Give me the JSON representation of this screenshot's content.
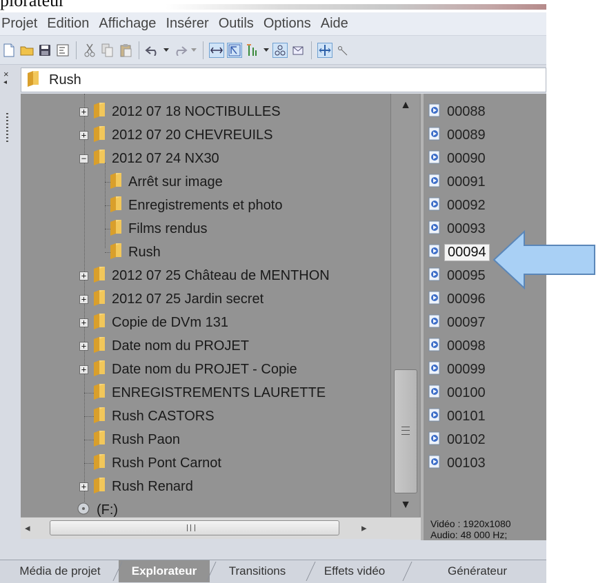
{
  "window": {
    "title_fragment": "plorateur"
  },
  "menubar": {
    "items": [
      "Projet",
      "Edition",
      "Affichage",
      "Insérer",
      "Outils",
      "Options",
      "Aide"
    ]
  },
  "toolbar": {
    "buttons": [
      "new-icon",
      "open-icon",
      "save-icon",
      "properties-icon",
      "cut-icon",
      "copy-icon",
      "paste-icon",
      "undo-icon",
      "redo-icon",
      "trim-icon",
      "select-icon",
      "ripple-icon",
      "snap-icon",
      "lock-icon",
      "split-icon"
    ]
  },
  "path": {
    "current": "Rush"
  },
  "tree": {
    "items": [
      {
        "label": "2012 07 18 NOCTIBULLES",
        "level": 1,
        "expander": "+"
      },
      {
        "label": "2012 07 20 CHEVREUILS",
        "level": 1,
        "expander": "+"
      },
      {
        "label": "2012 07 24 NX30",
        "level": 1,
        "expander": "−"
      },
      {
        "label": "Arrêt sur image",
        "level": 2,
        "expander": ""
      },
      {
        "label": "Enregistrements et photo",
        "level": 2,
        "expander": ""
      },
      {
        "label": "Films rendus",
        "level": 2,
        "expander": ""
      },
      {
        "label": "Rush",
        "level": 2,
        "expander": ""
      },
      {
        "label": "2012 07 25 Château de MENTHON",
        "level": 1,
        "expander": "+"
      },
      {
        "label": "2012 07 25 Jardin secret",
        "level": 1,
        "expander": "+"
      },
      {
        "label": "Copie de DVm 131",
        "level": 1,
        "expander": "+"
      },
      {
        "label": "Date nom du PROJET",
        "level": 1,
        "expander": "+"
      },
      {
        "label": "Date nom du PROJET - Copie",
        "level": 1,
        "expander": "+"
      },
      {
        "label": "ENREGISTREMENTS LAURETTE",
        "level": 1,
        "expander": ""
      },
      {
        "label": "Rush CASTORS",
        "level": 1,
        "expander": ""
      },
      {
        "label": "Rush Paon",
        "level": 1,
        "expander": ""
      },
      {
        "label": "Rush Pont Carnot",
        "level": 1,
        "expander": ""
      },
      {
        "label": "Rush Renard",
        "level": 1,
        "expander": "+"
      }
    ],
    "drive_label": "(F:)"
  },
  "hscroll": {
    "grip": "III"
  },
  "files": {
    "items": [
      "00088",
      "00089",
      "00090",
      "00091",
      "00092",
      "00093",
      "00094",
      "00095",
      "00096",
      "00097",
      "00098",
      "00099",
      "00100",
      "00101",
      "00102",
      "00103"
    ],
    "selected": "00094"
  },
  "file_info": {
    "video": "Vidéo : 1920x1080",
    "audio": "Audio: 48 000 Hz; "
  },
  "tabs": [
    "Média de projet",
    "Explorateur",
    "Transitions",
    "Effets vidéo",
    "Générateur"
  ],
  "active_tab": "Explorateur",
  "colors": {
    "annotation_arrow": "#a9d0f5",
    "pane_bg": "#939393",
    "folder": "#e8b84a"
  }
}
